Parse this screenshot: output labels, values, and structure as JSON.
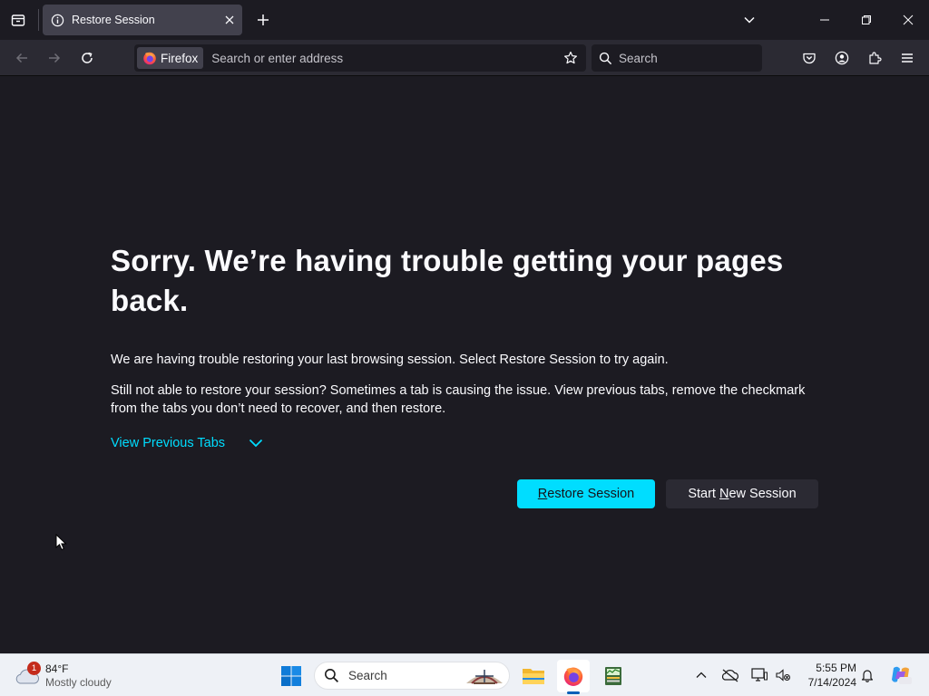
{
  "browser": {
    "tab": {
      "title": "Restore Session"
    },
    "urlbar": {
      "identity_label": "Firefox",
      "placeholder": "Search or enter address"
    },
    "searchbar": {
      "placeholder": "Search"
    }
  },
  "page": {
    "heading": "Sorry. We’re having trouble getting your pages back.",
    "paragraph1": "We are having trouble restoring your last browsing session. Select Restore Session to try again.",
    "paragraph2": "Still not able to restore your session? Sometimes a tab is causing the issue. View previous tabs, remove the checkmark from the tabs you don’t need to recover, and then restore.",
    "view_previous_tabs": "View Previous Tabs",
    "restore_button": {
      "access_key": "R",
      "rest": "estore Session"
    },
    "new_session_button": {
      "before": "Start ",
      "access_key": "N",
      "rest": "ew Session"
    }
  },
  "taskbar": {
    "weather": {
      "temp": "84°F",
      "condition": "Mostly cloudy",
      "badge": "1"
    },
    "search_label": "Search",
    "clock": {
      "time": "5:55 PM",
      "date": "7/14/2024"
    }
  },
  "colors": {
    "accent": "#00ddff",
    "page_bg": "#1c1b22",
    "toolbar_bg": "#2b2a33",
    "taskbar_bg": "#eef1f6"
  },
  "icons": {
    "tab_list": "tab-list-icon",
    "tab_info": "info-icon",
    "tab_close": "close-icon",
    "new_tab": "plus-icon",
    "list_all_tabs": "chevron-down-icon",
    "minimize": "minimize-icon",
    "restore": "restore-window-icon",
    "close_window": "close-icon",
    "back": "back-arrow-icon",
    "forward": "forward-arrow-icon",
    "reload": "reload-icon",
    "bookmark": "star-icon",
    "search": "search-icon",
    "pocket": "pocket-icon",
    "account": "account-icon",
    "extensions": "extensions-icon",
    "menu": "hamburger-menu-icon"
  }
}
